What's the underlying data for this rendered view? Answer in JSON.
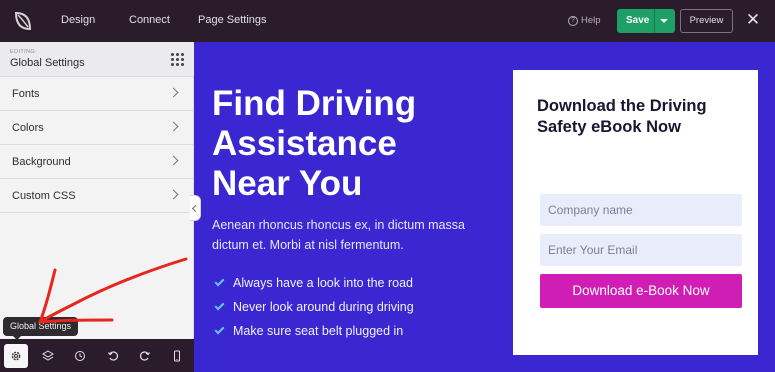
{
  "topbar": {
    "nav": [
      "Design",
      "Connect",
      "Page Settings"
    ],
    "help_label": "Help",
    "save_label": "Save",
    "preview_label": "Preview",
    "close_symbol": "✕",
    "colors": {
      "background": "#2a1c2b",
      "save": "#1e9f66"
    }
  },
  "sidebar": {
    "editing_label": "EDITING:",
    "editing_title": "Global Settings",
    "items": [
      {
        "label": "Fonts"
      },
      {
        "label": "Colors"
      },
      {
        "label": "Background"
      },
      {
        "label": "Custom CSS"
      }
    ]
  },
  "bottom_toolbar": {
    "tooltip": "Global Settings",
    "tools": [
      "gear-icon",
      "layers-icon",
      "history-icon",
      "undo-icon",
      "redo-icon",
      "mobile-icon"
    ]
  },
  "canvas": {
    "background": "#3b27d1",
    "hero_title": [
      "Find Driving",
      "Assistance",
      "Near You"
    ],
    "hero_body": "Aenean rhoncus rhoncus ex, in dictum massa dictum et. Morbi at nisl fermentum.",
    "checklist": [
      "Always have a look into the road",
      "Never look around during driving",
      "Make sure seat belt plugged in"
    ],
    "card": {
      "title": "Download the Driving Safety eBook Now",
      "company_placeholder": "Company name",
      "email_placeholder": "Enter Your Email",
      "cta_label": "Download e-Book Now",
      "cta_color": "#d01eb4"
    }
  },
  "annotation": {
    "color": "#e8261d"
  }
}
